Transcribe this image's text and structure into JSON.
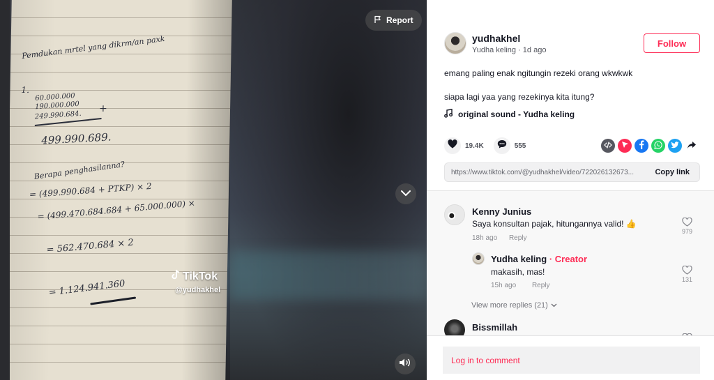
{
  "video": {
    "report_label": "Report",
    "watermark_brand": "TikTok",
    "watermark_user": "@yudhakhel",
    "handwriting": {
      "title": "Pemdukan mrtel yang dikrm/an paxk",
      "step1": "1.",
      "line_a": "60.000.000",
      "line_b": "190.000.000",
      "line_c": "249.990.684.",
      "plus": "+",
      "sum": "499.990.689.",
      "question": "Berapa penghasilanna?",
      "eq1": "= (499.990.684 + PTKP) × 2",
      "eq2": "= (499.470.684.684 + 65.000.000) ×",
      "eq3": "= 562.470.684 × 2",
      "eq4": "= 1.124.941.360"
    }
  },
  "post": {
    "username": "yudhakhel",
    "display_name": "Yudha keling",
    "time": "1d ago",
    "follow_label": "Follow",
    "caption_line1": "emang paling enak ngitungin rezeki orang wkwkwk",
    "caption_line2": "siapa lagi yaa yang rezekinya kita itung?",
    "sound": "original sound - Yudha keling",
    "likes": "19.4K",
    "comments": "555",
    "share_colors": {
      "embed": "#56575f",
      "send": "#fe2c55",
      "facebook": "#1877f2",
      "whatsapp": "#25d366",
      "twitter": "#1da1f2"
    },
    "link": "https://www.tiktok.com/@yudhakhel/video/722026132673...",
    "copy_label": "Copy link"
  },
  "comments": [
    {
      "user": "Kenny Junius",
      "text": "Saya konsultan pajak, hitungannya valid! 👍",
      "time": "18h ago",
      "reply_label": "Reply",
      "likes": "979"
    },
    {
      "user": "Yudha keling",
      "badge": "Creator",
      "separator": "·",
      "text": "makasih, mas!",
      "time": "15h ago",
      "reply_label": "Reply",
      "likes": "131"
    },
    {
      "user": "Bissmillah"
    }
  ],
  "view_more": "View more replies (21)",
  "login_prompt": "Log in to comment"
}
